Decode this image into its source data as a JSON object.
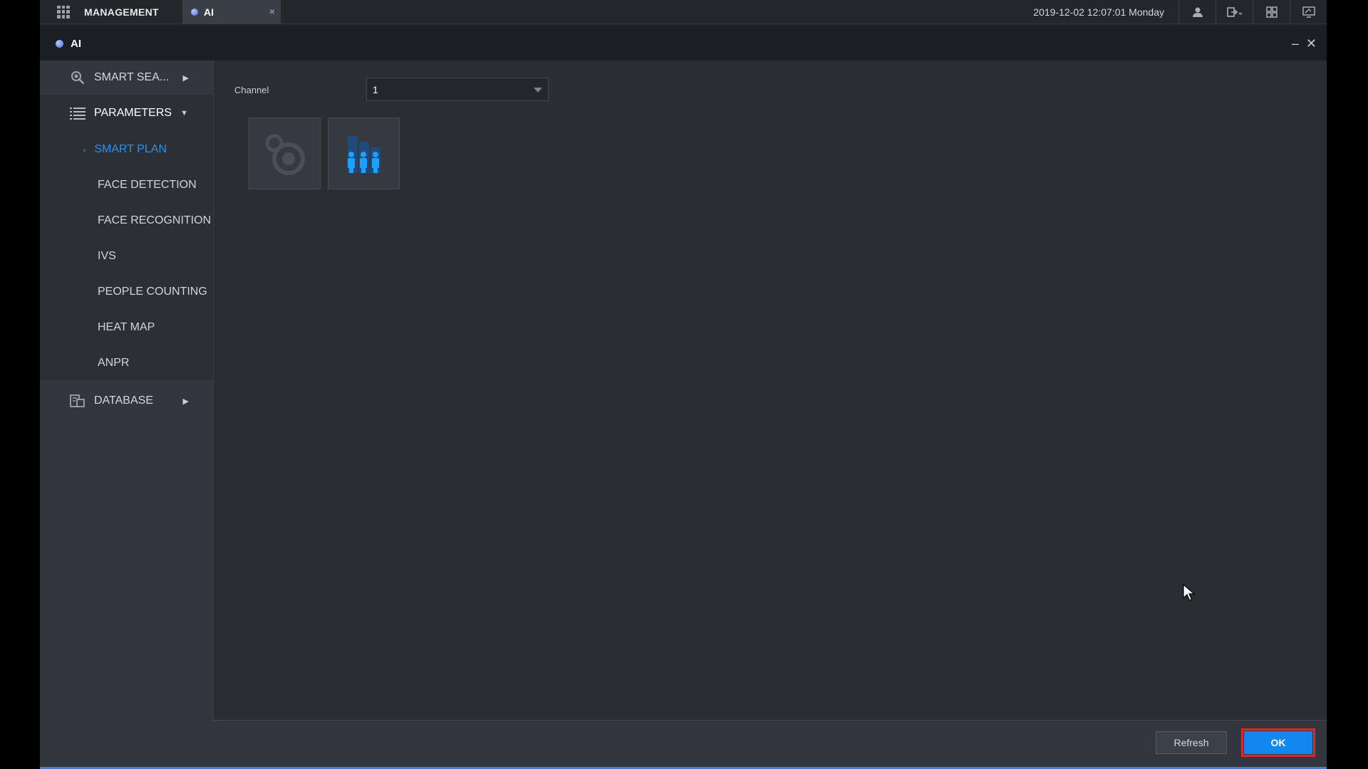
{
  "topbar": {
    "menu_label": "MANAGEMENT",
    "tab_label": "AI",
    "tab_close": "×",
    "datetime": "2019-12-02 12:07:01 Monday"
  },
  "window": {
    "title": "AI",
    "minimize": "–",
    "close": "✕"
  },
  "sidebar": {
    "smart_search": "SMART SEA...",
    "parameters": "PARAMETERS",
    "items": [
      {
        "label": "SMART PLAN",
        "active": true
      },
      {
        "label": "FACE DETECTION"
      },
      {
        "label": "FACE RECOGNITION"
      },
      {
        "label": "IVS"
      },
      {
        "label": "PEOPLE COUNTING"
      },
      {
        "label": "HEAT MAP"
      },
      {
        "label": "ANPR"
      }
    ],
    "database": "DATABASE"
  },
  "main": {
    "channel_label": "Channel",
    "channel_value": "1",
    "plans": [
      {
        "icon": "camera-lens-icon",
        "state": "disabled"
      },
      {
        "icon": "people-counting-icon",
        "state": "enabled"
      }
    ]
  },
  "footer": {
    "refresh_label": "Refresh",
    "ok_label": "OK"
  },
  "colors": {
    "accent": "#1287f0",
    "active_nav": "#2f8fe6",
    "highlight_border": "#e0262b"
  }
}
